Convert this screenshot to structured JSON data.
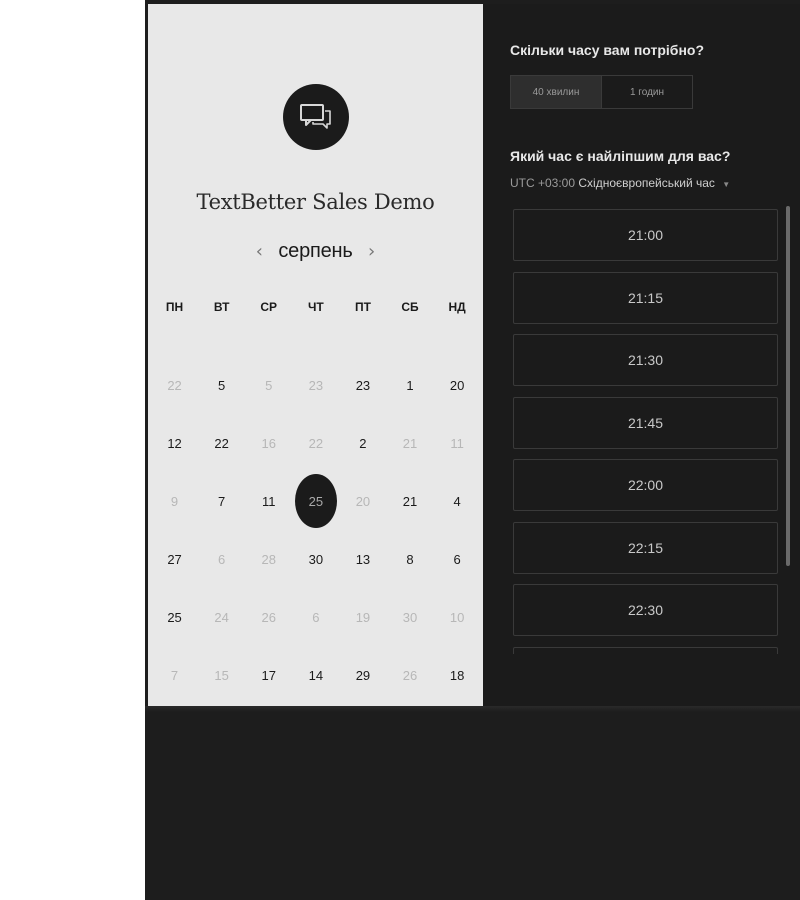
{
  "event": {
    "title": "TextBetter Sales Demo",
    "logo_icon": "chat-bubbles-icon"
  },
  "calendar": {
    "month": "серпень",
    "prev_arrow": "‹",
    "next_arrow": "›",
    "weekdays": [
      "ПН",
      "ВТ",
      "СР",
      "ЧТ",
      "ПТ",
      "СБ",
      "НД"
    ],
    "weeks": [
      [
        {
          "d": "22",
          "on": false
        },
        {
          "d": "5",
          "on": true
        },
        {
          "d": "5",
          "on": false
        },
        {
          "d": "23",
          "on": false
        },
        {
          "d": "23",
          "on": true
        },
        {
          "d": "1",
          "on": true
        },
        {
          "d": "20",
          "on": true
        }
      ],
      [
        {
          "d": "12",
          "on": true
        },
        {
          "d": "22",
          "on": true
        },
        {
          "d": "16",
          "on": false
        },
        {
          "d": "22",
          "on": false
        },
        {
          "d": "2",
          "on": true
        },
        {
          "d": "21",
          "on": false
        },
        {
          "d": "11",
          "on": false
        }
      ],
      [
        {
          "d": "9",
          "on": false
        },
        {
          "d": "7",
          "on": true
        },
        {
          "d": "11",
          "on": true
        },
        {
          "d": "25",
          "on": true,
          "selected": true
        },
        {
          "d": "20",
          "on": false
        },
        {
          "d": "21",
          "on": true
        },
        {
          "d": "4",
          "on": true
        }
      ],
      [
        {
          "d": "27",
          "on": true
        },
        {
          "d": "6",
          "on": false
        },
        {
          "d": "28",
          "on": false
        },
        {
          "d": "30",
          "on": true
        },
        {
          "d": "13",
          "on": true
        },
        {
          "d": "8",
          "on": true
        },
        {
          "d": "6",
          "on": true
        }
      ],
      [
        {
          "d": "25",
          "on": true
        },
        {
          "d": "24",
          "on": false
        },
        {
          "d": "26",
          "on": false
        },
        {
          "d": "6",
          "on": false
        },
        {
          "d": "19",
          "on": false
        },
        {
          "d": "30",
          "on": false
        },
        {
          "d": "10",
          "on": false
        }
      ],
      [
        {
          "d": "7",
          "on": false
        },
        {
          "d": "15",
          "on": false
        },
        {
          "d": "17",
          "on": true
        },
        {
          "d": "14",
          "on": true
        },
        {
          "d": "29",
          "on": true
        },
        {
          "d": "26",
          "on": false
        },
        {
          "d": "18",
          "on": true
        }
      ]
    ]
  },
  "duration": {
    "heading": "Скільки часу вам потрібно?",
    "options": [
      "40 хвилин",
      "1 годин"
    ],
    "selected": "40 хвилин"
  },
  "time": {
    "heading": "Який час є найліпшим для вас?",
    "tz_offset": "UTC +03:00",
    "tz_name": "Східноєвропейський час",
    "slots": [
      "21:00",
      "21:15",
      "21:30",
      "21:45",
      "22:00",
      "22:15",
      "22:30",
      ""
    ]
  },
  "colors": {
    "left_bg": "#e8e8e8",
    "right_bg": "#1b1b1b",
    "selected_day": "#1b1b1b"
  }
}
